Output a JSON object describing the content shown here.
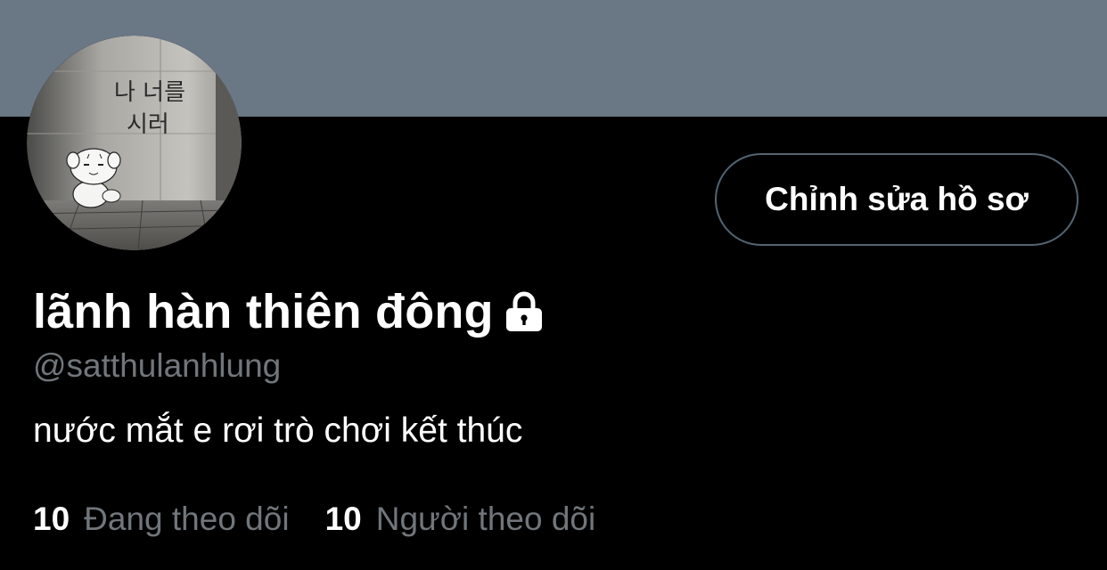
{
  "profile": {
    "display_name": "lãnh hàn thiên đông",
    "protected_icon": "lock-icon",
    "handle": "@satthulanhlung",
    "bio": "nước mắt e rơi trò chơi kết thúc",
    "avatar_graffiti": "나 너를 시러",
    "edit_button_label": "Chỉnh sửa hồ sơ"
  },
  "stats": {
    "following_count": "10",
    "following_label": "Đang theo dõi",
    "followers_count": "10",
    "followers_label": "Người theo dõi"
  },
  "colors": {
    "banner": "#6a7785",
    "background": "#000000",
    "secondary_text": "#71767b",
    "button_border": "#536471"
  }
}
